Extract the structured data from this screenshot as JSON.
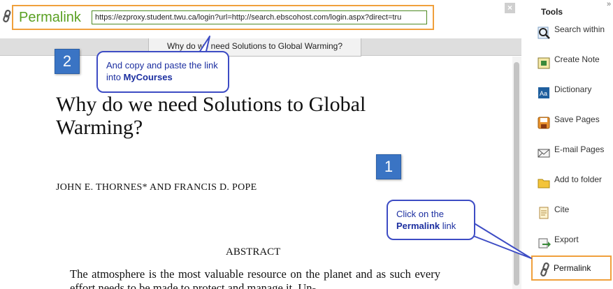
{
  "permalink_bar": {
    "label": "Permalink",
    "url": "https://ezproxy.student.twu.ca/login?url=http://search.ebscohost.com/login.aspx?direct=tru",
    "close_label": "×"
  },
  "document": {
    "tab_title": "Why do we need Solutions to Global Warming?",
    "title": "Why do we need Solutions to Global Warming?",
    "authors": "JOHN E. THORNES* AND FRANCIS D. POPE",
    "abstract_heading": "ABSTRACT",
    "abstract_text": "The atmosphere is the most valuable resource on the planet and as such every effort needs to be made to protect and manage it. Un-"
  },
  "tools": {
    "title": "Tools",
    "expand_label": "»",
    "items": [
      {
        "label": "Search within",
        "icon": "search-within-icon"
      },
      {
        "label": "Create Note",
        "icon": "create-note-icon"
      },
      {
        "label": "Dictionary",
        "icon": "dictionary-icon"
      },
      {
        "label": "Save Pages",
        "icon": "save-icon"
      },
      {
        "label": "E-mail Pages",
        "icon": "email-icon"
      },
      {
        "label": "Add to folder",
        "icon": "folder-icon"
      },
      {
        "label": "Cite",
        "icon": "cite-icon"
      },
      {
        "label": "Export",
        "icon": "export-icon"
      },
      {
        "label": "Permalink",
        "icon": "permalink-icon"
      }
    ]
  },
  "callouts": {
    "step1": {
      "number": "1",
      "text_before": "Click on the",
      "emphasis": "Permalink",
      "text_after": "link"
    },
    "step2": {
      "number": "2",
      "text_before": "And copy and paste the link into",
      "emphasis": "MyCourses"
    }
  },
  "colors": {
    "highlight_orange": "#f0a03c",
    "permalink_green": "#5aa023",
    "callout_blue": "#3d4cc4",
    "badge_blue": "#3a74c4"
  }
}
